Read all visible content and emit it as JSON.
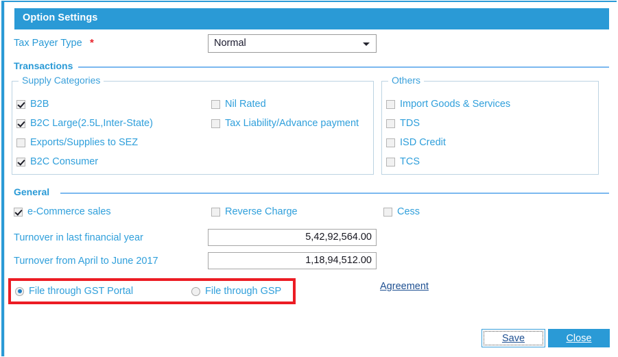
{
  "window": {
    "title": "Option Settings",
    "accent_color": "#2a9ad6",
    "link_color": "#2f9fdb",
    "required_color": "#e8222a",
    "highlight_color": "#ec1c24"
  },
  "taxpayer": {
    "label": "Tax Payer Type",
    "required_marker": "*",
    "selected": "Normal",
    "options": [
      "Normal"
    ]
  },
  "sections": {
    "transactions": "Transactions",
    "general": "General"
  },
  "supply_categories": {
    "legend": "Supply Categories",
    "left_items": [
      {
        "label": "B2B",
        "checked": true
      },
      {
        "label": "B2C Large(2.5L,Inter-State)",
        "checked": true
      },
      {
        "label": "Exports/Supplies to SEZ",
        "checked": false
      },
      {
        "label": "B2C Consumer",
        "checked": true
      }
    ],
    "right_items": [
      {
        "label": "Nil Rated",
        "checked": false
      },
      {
        "label": "Tax Liability/Advance payment",
        "checked": false
      }
    ]
  },
  "others": {
    "legend": "Others",
    "items": [
      {
        "label": "Import Goods & Services",
        "checked": false
      },
      {
        "label": "TDS",
        "checked": false
      },
      {
        "label": "ISD Credit",
        "checked": false
      },
      {
        "label": "TCS",
        "checked": false
      }
    ]
  },
  "general": {
    "checkboxes": [
      {
        "label": "e-Commerce sales",
        "checked": true
      },
      {
        "label": "Reverse Charge",
        "checked": false
      },
      {
        "label": "Cess",
        "checked": false
      }
    ],
    "turnover_last_year": {
      "label": "Turnover in last financial year",
      "value": "5,42,92,564.00"
    },
    "turnover_apr_jun": {
      "label": "Turnover from April to June 2017",
      "value": "1,18,94,512.00"
    }
  },
  "filing": {
    "options": [
      {
        "label": "File through GST Portal",
        "selected": true
      },
      {
        "label": "File through GSP",
        "selected": false
      }
    ],
    "agreement_link": "Agreement"
  },
  "buttons": {
    "save": "Save",
    "close": "Close"
  }
}
